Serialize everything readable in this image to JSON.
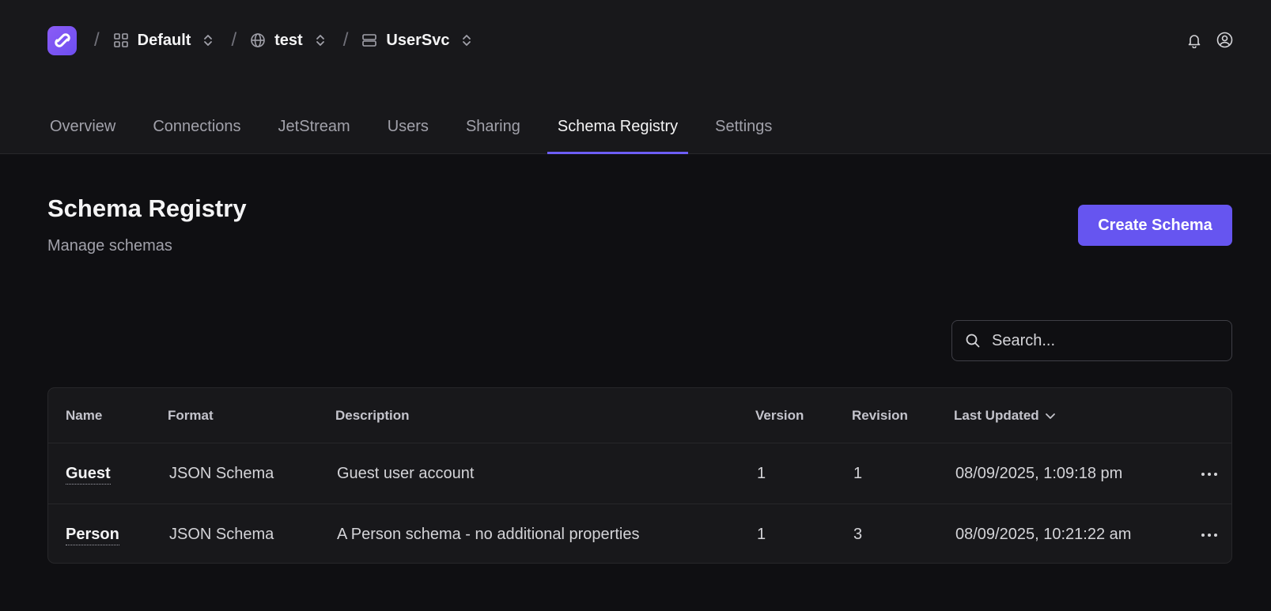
{
  "breadcrumb": {
    "account": "Default",
    "system": "test",
    "service": "UserSvc"
  },
  "tabs": [
    "Overview",
    "Connections",
    "JetStream",
    "Users",
    "Sharing",
    "Schema Registry",
    "Settings"
  ],
  "active_tab": "Schema Registry",
  "page": {
    "title": "Schema Registry",
    "subtitle": "Manage schemas",
    "create_label": "Create Schema"
  },
  "search": {
    "placeholder": "Search...",
    "value": ""
  },
  "table": {
    "headers": {
      "name": "Name",
      "format": "Format",
      "description": "Description",
      "version": "Version",
      "revision": "Revision",
      "last_updated": "Last Updated"
    },
    "rows": [
      {
        "name": "Guest",
        "format": "JSON Schema",
        "description": "Guest user account",
        "version": "1",
        "revision": "1",
        "last_updated": "08/09/2025, 1:09:18 pm"
      },
      {
        "name": "Person",
        "format": "JSON Schema",
        "description": "A Person schema - no additional properties",
        "version": "1",
        "revision": "3",
        "last_updated": "08/09/2025, 10:21:22 am"
      }
    ]
  },
  "icons": {
    "logo": "synadia-logo-icon",
    "account": "grid-icon",
    "system": "globe-icon",
    "service": "server-icon",
    "notifications": "bell-icon",
    "profile": "user-circle-icon",
    "search": "search-icon",
    "sort": "chevron-down-icon",
    "row_menu": "more-horizontal-icon"
  },
  "colors": {
    "accent": "#6655f0",
    "background": "#0f0f12",
    "panel": "#18181b"
  }
}
